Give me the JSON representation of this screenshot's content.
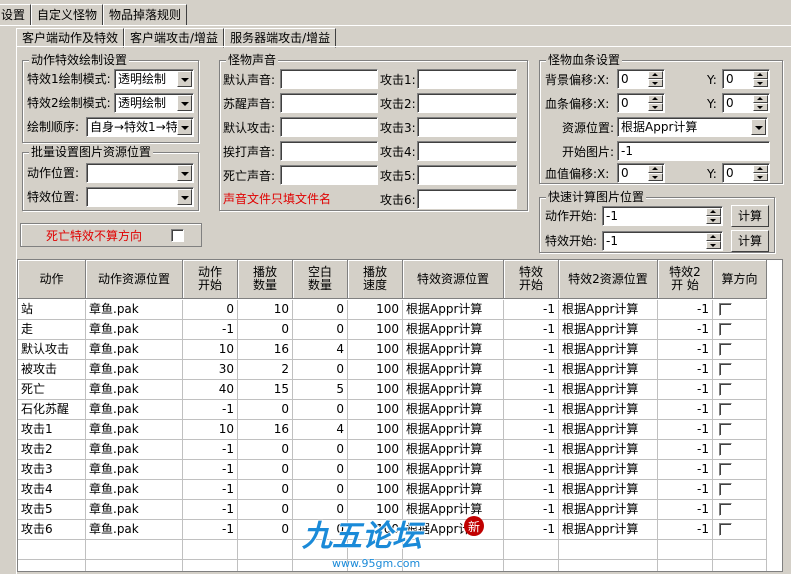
{
  "top_tabs": [
    "设置",
    "自定义怪物",
    "物品掉落规则"
  ],
  "sub_tabs": [
    "客户端动作及特效",
    "客户端攻击/增益",
    "服务器端攻击/增益"
  ],
  "action_fx": {
    "title": "动作特效绘制设置",
    "fx1_label": "特效1绘制模式:",
    "fx1_value": "透明绘制",
    "fx2_label": "特效2绘制模式:",
    "fx2_value": "透明绘制",
    "order_label": "绘制顺序:",
    "order_value": "自身→特效1→特"
  },
  "batch": {
    "title": "批量设置图片资源位置",
    "action_label": "动作位置:",
    "action_value": "",
    "fx_label": "特效位置:",
    "fx_value": ""
  },
  "death_fx_label": "死亡特效不算方向",
  "sound": {
    "title": "怪物声音",
    "rows": [
      {
        "label": "默认声音:",
        "value": "",
        "atk_label": "攻击1:",
        "atk_value": ""
      },
      {
        "label": "苏醒声音:",
        "value": "",
        "atk_label": "攻击2:",
        "atk_value": ""
      },
      {
        "label": "默认攻击:",
        "value": "",
        "atk_label": "攻击3:",
        "atk_value": ""
      },
      {
        "label": "挨打声音:",
        "value": "",
        "atk_label": "攻击4:",
        "atk_value": ""
      },
      {
        "label": "死亡声音:",
        "value": "",
        "atk_label": "攻击5:",
        "atk_value": ""
      }
    ],
    "note": "声音文件只填文件名",
    "atk6_label": "攻击6:",
    "atk6_value": ""
  },
  "hpbar": {
    "title": "怪物血条设置",
    "bg_label": "背景偏移:X:",
    "bg_x": "0",
    "bg_y_label": "Y:",
    "bg_y": "0",
    "bar_label": "血条偏移:X:",
    "bar_x": "0",
    "bar_y_label": "Y:",
    "bar_y": "0",
    "res_label": "资源位置:",
    "res_value": "根据Appr计算",
    "start_label": "开始图片:",
    "start_value": "-1",
    "val_label": "血值偏移:X:",
    "val_x": "0",
    "val_y_label": "Y:",
    "val_y": "0"
  },
  "quick": {
    "title": "快速计算图片位置",
    "action_label": "动作开始:",
    "action_value": "-1",
    "fx_label": "特效开始:",
    "fx_value": "-1",
    "calc_label": "计算"
  },
  "grid": {
    "headers": [
      "动作",
      "动作资源位置",
      "动作\n开始",
      "播放\n数量",
      "空白\n数量",
      "播放\n速度",
      "特效资源位置",
      "特效\n开始",
      "特效2资源位置",
      "特效2\n开 始",
      "算方向"
    ],
    "rows": [
      [
        "站",
        "章鱼.pak",
        "0",
        "10",
        "0",
        "100",
        "根据Appr计算",
        "-1",
        "根据Appr计算",
        "-1"
      ],
      [
        "走",
        "章鱼.pak",
        "-1",
        "0",
        "0",
        "100",
        "根据Appr计算",
        "-1",
        "根据Appr计算",
        "-1"
      ],
      [
        "默认攻击",
        "章鱼.pak",
        "10",
        "16",
        "4",
        "100",
        "根据Appr计算",
        "-1",
        "根据Appr计算",
        "-1"
      ],
      [
        "被攻击",
        "章鱼.pak",
        "30",
        "2",
        "0",
        "100",
        "根据Appr计算",
        "-1",
        "根据Appr计算",
        "-1"
      ],
      [
        "死亡",
        "章鱼.pak",
        "40",
        "15",
        "5",
        "100",
        "根据Appr计算",
        "-1",
        "根据Appr计算",
        "-1"
      ],
      [
        "石化苏醒",
        "章鱼.pak",
        "-1",
        "0",
        "0",
        "100",
        "根据Appr计算",
        "-1",
        "根据Appr计算",
        "-1"
      ],
      [
        "攻击1",
        "章鱼.pak",
        "10",
        "16",
        "4",
        "100",
        "根据Appr计算",
        "-1",
        "根据Appr计算",
        "-1"
      ],
      [
        "攻击2",
        "章鱼.pak",
        "-1",
        "0",
        "0",
        "100",
        "根据Appr计算",
        "-1",
        "根据Appr计算",
        "-1"
      ],
      [
        "攻击3",
        "章鱼.pak",
        "-1",
        "0",
        "0",
        "100",
        "根据Appr计算",
        "-1",
        "根据Appr计算",
        "-1"
      ],
      [
        "攻击4",
        "章鱼.pak",
        "-1",
        "0",
        "0",
        "100",
        "根据Appr计算",
        "-1",
        "根据Appr计算",
        "-1"
      ],
      [
        "攻击5",
        "章鱼.pak",
        "-1",
        "0",
        "0",
        "100",
        "根据Appr计算",
        "-1",
        "根据Appr计算",
        "-1"
      ],
      [
        "攻击6",
        "章鱼.pak",
        "-1",
        "0",
        "0",
        "100",
        "根据Appr计算",
        "-1",
        "根据Appr计算",
        "-1"
      ]
    ]
  },
  "watermark": {
    "brand": "九五论坛",
    "url": "www.95gm.com",
    "badge": "新"
  },
  "colors": {
    "face": "#d4d0c8",
    "warn_red": "#e00000",
    "brand_blue": "#1a8ad8"
  }
}
